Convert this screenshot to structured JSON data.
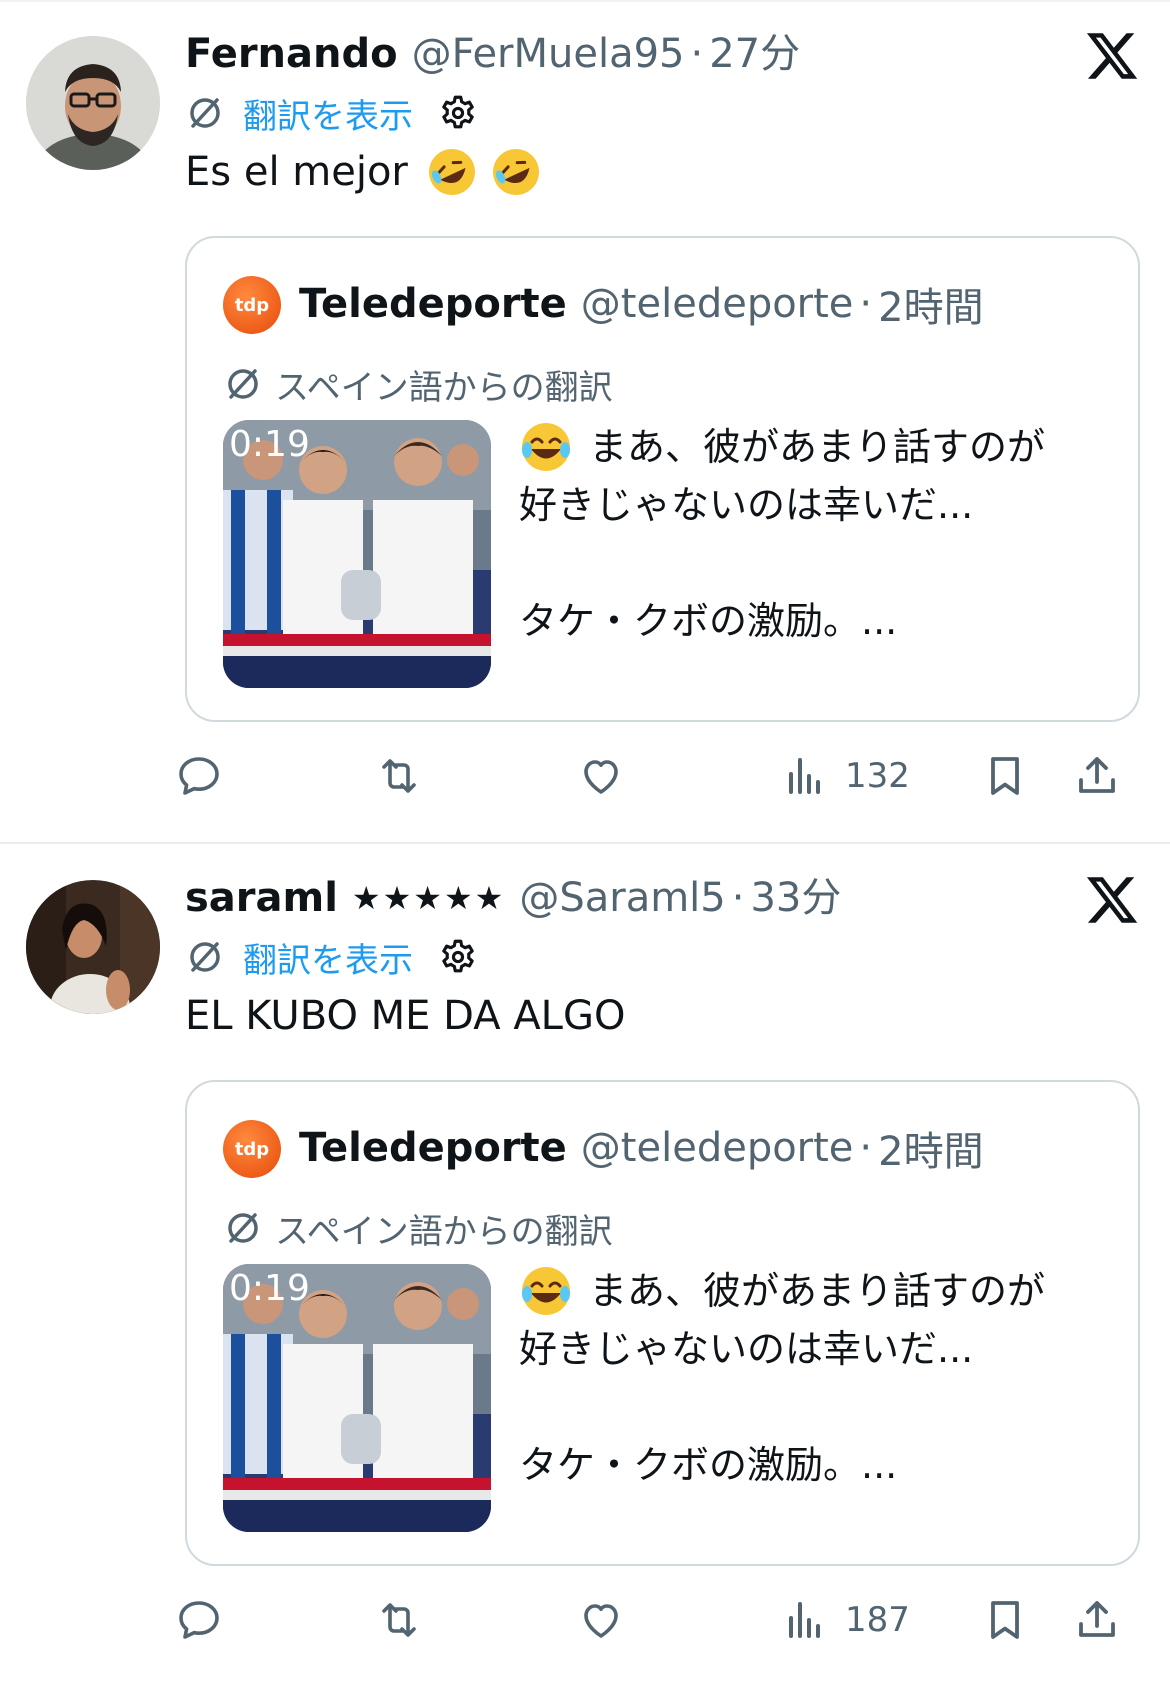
{
  "posts": [
    {
      "name": "Fernando",
      "stars": "",
      "handle": "@FerMuela95",
      "separator": "·",
      "time": "27分",
      "translate_label": "翻訳を表示",
      "text": "Es el mejor",
      "text_emojis": [
        "rolling-on-floor-laughing-emoji",
        "rolling-on-floor-laughing-emoji"
      ],
      "quote": {
        "avatar_text": "tdp",
        "name": "Teledeporte",
        "handle": "@teledeporte",
        "separator": "·",
        "time": "2時間",
        "translated_label": "スペイン語からの翻訳",
        "duration": "0:19",
        "text_line1": "まあ、彼があまり話すのが",
        "text_line2": "好きじゃないのは幸いだ...",
        "text_line3": "タケ・クボの激励。..."
      },
      "views": "132"
    },
    {
      "name": "saraml",
      "stars": "★★★★★",
      "handle": "@Saraml5",
      "separator": "·",
      "time": "33分",
      "translate_label": "翻訳を表示",
      "text": "EL KUBO ME DA ALGO",
      "text_emojis": [],
      "quote": {
        "avatar_text": "tdp",
        "name": "Teledeporte",
        "handle": "@teledeporte",
        "separator": "·",
        "time": "2時間",
        "translated_label": "スペイン語からの翻訳",
        "duration": "0:19",
        "text_line1": "まあ、彼があまり話すのが",
        "text_line2": "好きじゃないのは幸いだ...",
        "text_line3": "タケ・クボの激励。..."
      },
      "views": "187"
    }
  ],
  "colors": {
    "link_blue": "#1d9bf0",
    "secondary_text": "#536471",
    "border": "#cfd9de",
    "tdp_orange": "#e64a0a"
  }
}
